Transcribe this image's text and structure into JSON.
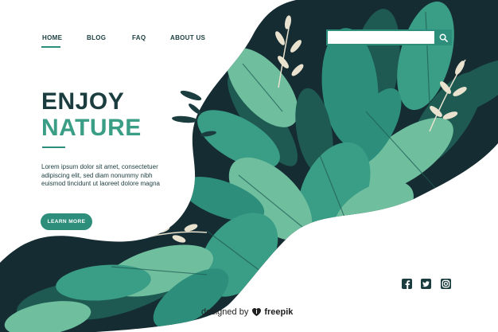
{
  "nav": {
    "items": [
      {
        "label": "HOME",
        "active": true
      },
      {
        "label": "BLOG",
        "active": false
      },
      {
        "label": "FAQ",
        "active": false
      },
      {
        "label": "ABOUT US",
        "active": false
      }
    ]
  },
  "hero": {
    "title_line1": "ENJOY",
    "title_line2": "NATURE",
    "body_lines": [
      "Lorem ipsum dolor sit amet, consectetuer",
      "adipiscing elit, sed diam nonummy nibh",
      "euismod tincidunt ut laoreet dolore magna"
    ],
    "cta_label": "LEARN MORE"
  },
  "search": {
    "value": "",
    "placeholder": "",
    "icon": "search-icon"
  },
  "social": {
    "icons": [
      "facebook-icon",
      "twitter-icon",
      "instagram-icon"
    ]
  },
  "credit": {
    "prefix": "designed by",
    "brand": "freepik",
    "icon": "freepik-logo-icon"
  },
  "colors": {
    "dark_teal": "#1b3d3f",
    "accent_green": "#3a9d85",
    "leaf_light": "#6fbf9f",
    "leaf_mid": "#2d8f7b",
    "leaf_dark": "#1e5a52",
    "background_dark": "#152c33",
    "sprig": "#e9e2cf"
  }
}
